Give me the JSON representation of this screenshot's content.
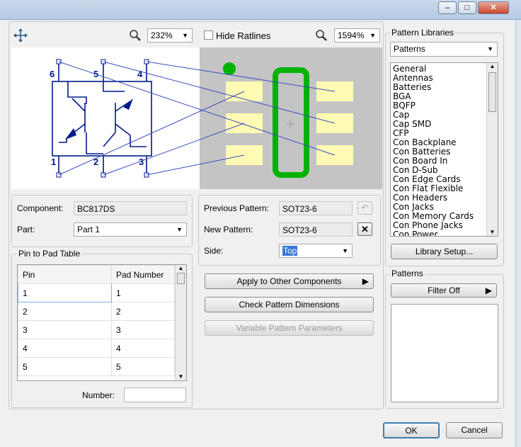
{
  "toolbar": {
    "zoom_left": "232%",
    "hide_ratlines_label": "Hide Ratlines",
    "zoom_right": "1594%"
  },
  "schematic": {
    "pins": [
      "6",
      "5",
      "4",
      "1",
      "2",
      "3"
    ]
  },
  "component": {
    "label": "Component:",
    "value": "BC817DS",
    "part_label": "Part:",
    "part_value": "Part 1"
  },
  "pattern": {
    "previous_label": "Previous Pattern:",
    "previous_value": "SOT23-6",
    "new_label": "New Pattern:",
    "new_value": "SOT23-6",
    "side_label": "Side:",
    "side_value": "Top"
  },
  "pin_table": {
    "title": "Pin to Pad Table",
    "headers": [
      "Pin",
      "Pad Number"
    ],
    "rows": [
      [
        "1",
        "1"
      ],
      [
        "2",
        "2"
      ],
      [
        "3",
        "3"
      ],
      [
        "4",
        "4"
      ],
      [
        "5",
        "5"
      ]
    ],
    "number_label": "Number:"
  },
  "actions": {
    "apply": "Apply to Other Components",
    "check": "Check Pattern Dimensions",
    "variable": "Variable Pattern Parameters"
  },
  "libraries": {
    "title": "Pattern Libraries",
    "selected": "Patterns",
    "items": [
      "General",
      "Antennas",
      "Batteries",
      "BGA",
      "BQFP",
      "Cap",
      "Cap SMD",
      "CFP",
      "Con Backplane",
      "Con Batteries",
      "Con Board In",
      "Con D-Sub",
      "Con Edge Cards",
      "Con Flat Flexible",
      "Con Headers",
      "Con Jacks",
      "Con Memory Cards",
      "Con Phone Jacks",
      "Con Power"
    ],
    "setup": "Library Setup..."
  },
  "patterns_box": {
    "title": "Patterns",
    "filter": "Filter Off"
  },
  "dialog": {
    "ok": "OK",
    "cancel": "Cancel"
  },
  "colors": {
    "pad": "#fffbb4",
    "pad_bg": "#c4c4c4",
    "outline": "#00b300",
    "schematic": "#001a8c",
    "ratline": "#3a4ec4",
    "selection": "#3375d6"
  }
}
